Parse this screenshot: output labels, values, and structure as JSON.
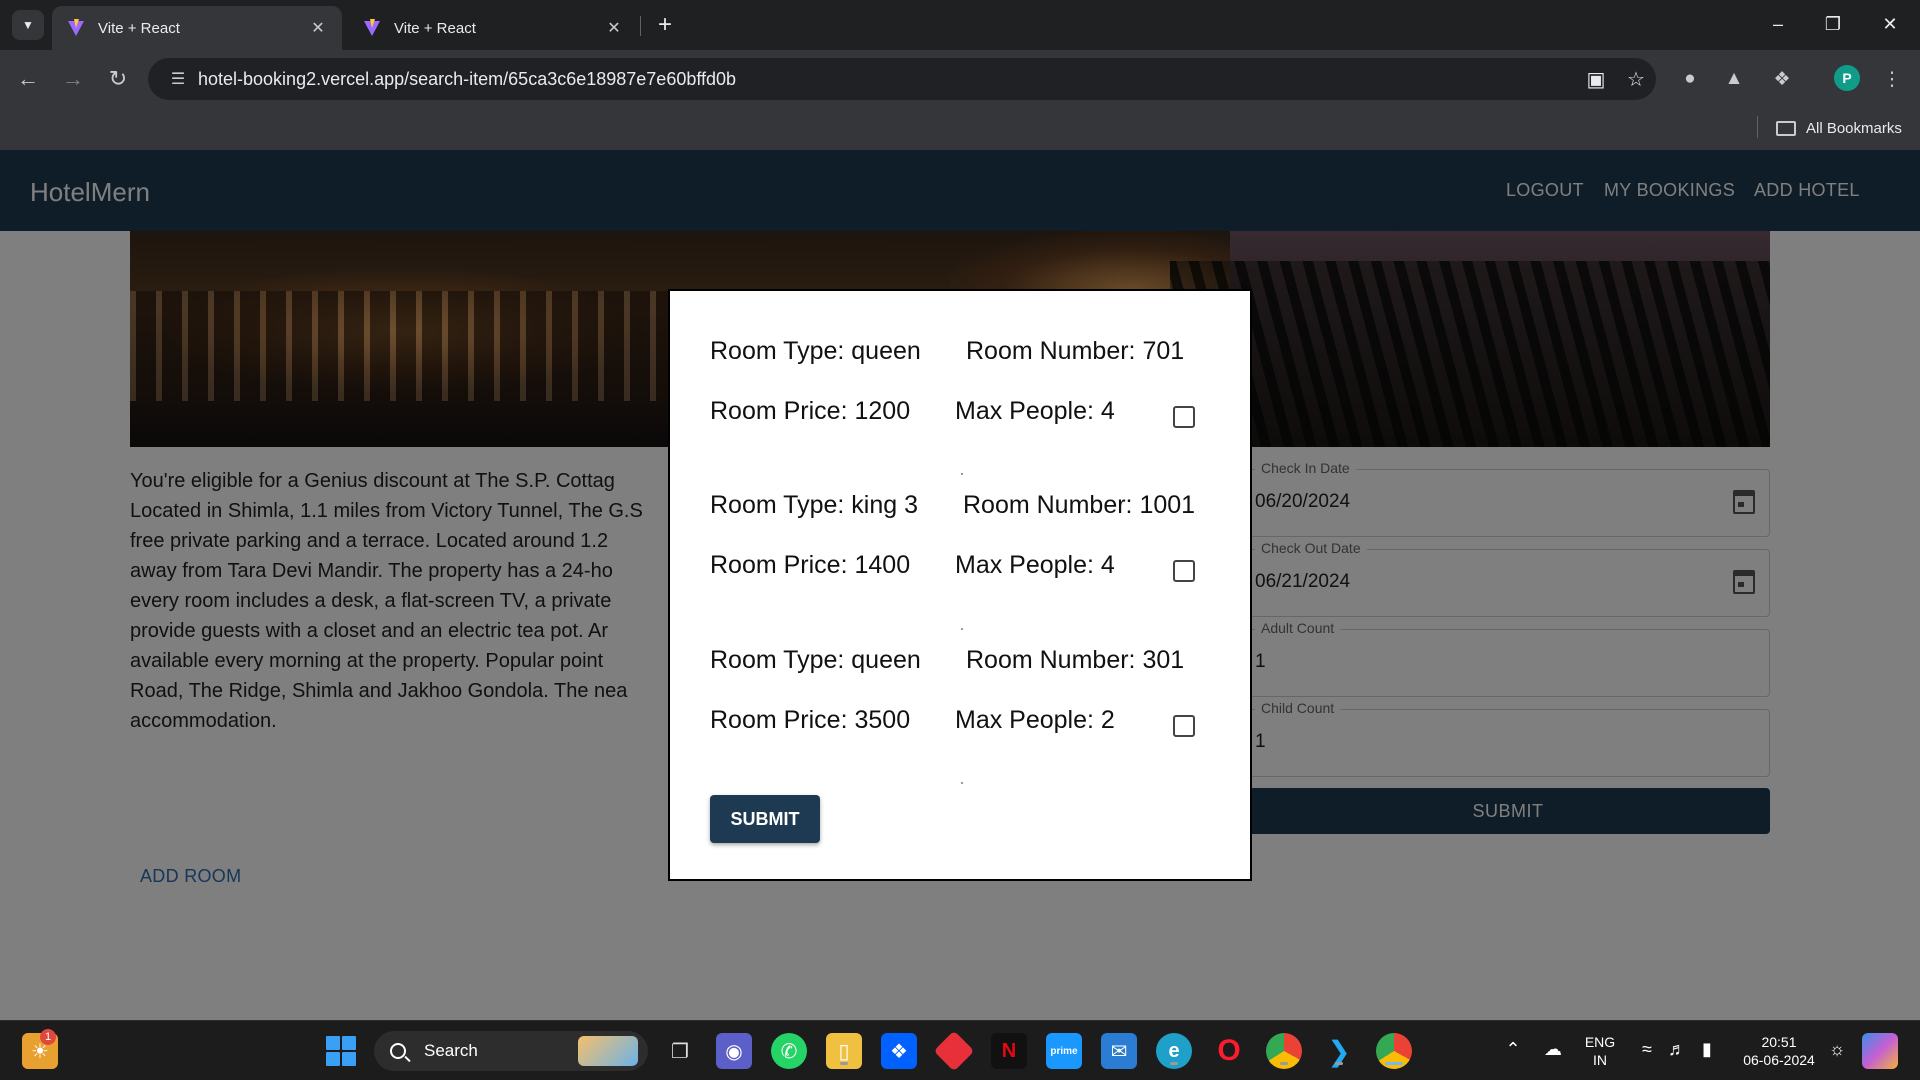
{
  "browser": {
    "tabs": [
      {
        "title": "Vite + React",
        "active": true
      },
      {
        "title": "Vite + React",
        "active": false
      }
    ],
    "url": "hotel-booking2.vercel.app/search-item/65ca3c6e18987e7e60bffd0b",
    "bookmarks_label": "All Bookmarks",
    "profile_initial": "P"
  },
  "app": {
    "brand": "HotelMern",
    "nav": [
      "LOGOUT",
      "MY BOOKINGS",
      "ADD HOTEL"
    ]
  },
  "hotel": {
    "description_lines": [
      "You're eligible for a Genius discount at The S.P. Cottag",
      "Located in Shimla, 1.1 miles from Victory Tunnel, The G.S",
      "free private parking and a terrace. Located around 1.2",
      "away from Tara Devi Mandir. The property has a 24-ho",
      "every room includes a desk, a flat-screen TV, a private",
      "provide guests with a closet and an electric tea pot. Ar",
      "available every morning at the property. Popular point",
      "Road, The Ridge, Shimla and Jakhoo Gondola. The nea",
      "accommodation."
    ],
    "add_room_label": "ADD ROOM"
  },
  "booking_form": {
    "check_in": {
      "label": "Check In Date",
      "value": "06/20/2024"
    },
    "check_out": {
      "label": "Check Out Date",
      "value": "06/21/2024"
    },
    "adult": {
      "label": "Adult Count",
      "value": "1"
    },
    "child": {
      "label": "Child Count",
      "value": "1"
    },
    "submit_label": "SUBMIT"
  },
  "modal": {
    "rooms": [
      {
        "type": "Room Type: queen",
        "number": "Room Number: 701",
        "price": "Room Price: 1200",
        "max_people": "Max People: 4",
        "checked": false
      },
      {
        "type": "Room Type: king 3",
        "number": "Room Number: 1001",
        "price": "Room Price: 1400",
        "max_people": "Max People: 4",
        "checked": false
      },
      {
        "type": "Room Type: queen",
        "number": "Room Number: 301",
        "price": "Room Price: 3500",
        "max_people": "Max People: 2",
        "checked": false
      }
    ],
    "submit_label": "SUBMIT"
  },
  "taskbar": {
    "search_label": "Search",
    "notification_count": "1",
    "language": "ENG",
    "region": "IN",
    "time": "20:51",
    "date": "06-06-2024"
  },
  "colors": {
    "appbar": "#1e3a52",
    "link": "#2f6db4",
    "overlay": "rgba(0,0,0,0.5)"
  }
}
